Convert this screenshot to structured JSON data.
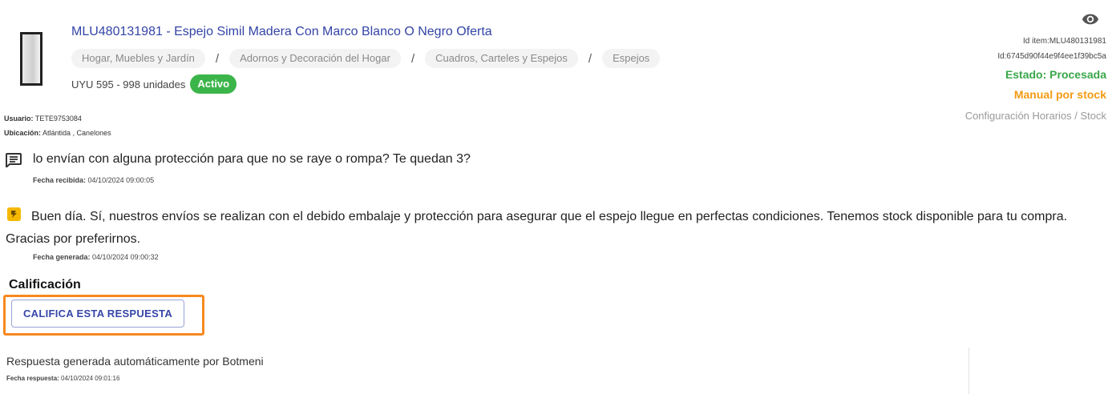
{
  "listing": {
    "title": "MLU480131981 - Espejo Simil Madera Con Marco Blanco O Negro Oferta",
    "breadcrumbs": [
      "Hogar, Muebles y Jardín",
      "Adornos y Decoración del Hogar",
      "Cuadros, Carteles y Espejos",
      "Espejos"
    ],
    "separator": "/",
    "price": "UYU 595 - 998 unidades",
    "status_badge": "Activo",
    "status_color": "#3bb54a"
  },
  "side": {
    "eye_icon": "eye-icon",
    "id_item": "Id item:MLU480131981",
    "id_hash": "Id:6745d90f44e9f4ee1f39bc5a",
    "estado": "Estado: Procesada",
    "manual": "Manual por stock",
    "config_link": "Configuración Horarios / Stock"
  },
  "user": {
    "usuario_label": "Usuario:",
    "usuario": "TETE9753084",
    "ubicacion_label": "Ubicación:",
    "ubicacion": "Atlántida , Canelones"
  },
  "question": {
    "icon": "message-icon",
    "text": "lo envían con alguna protección para que no se raye o rompa? Te quedan 3?",
    "date_label": "Fecha recibida:",
    "date": "04/10/2024 09:00:05"
  },
  "answer": {
    "icon": "bot-icon",
    "text": "Buen día. Sí, nuestros envíos se realizan con el debido embalaje y protección para asegurar que el espejo llegue en perfectas condiciones. Tenemos stock disponible para tu compra. Gracias por preferirnos.",
    "date_label": "Fecha generada:",
    "date": "04/10/2024 09:00:32"
  },
  "rating": {
    "title": "Calificación",
    "button_label": "CALIFICA ESTA RESPUESTA",
    "highlight_color": "#f7891f"
  },
  "footer": {
    "auto_text": "Respuesta generada automáticamente por Botmeni",
    "date_label": "Fecha respuesta:",
    "date": "04/10/2024 09:01:16"
  }
}
